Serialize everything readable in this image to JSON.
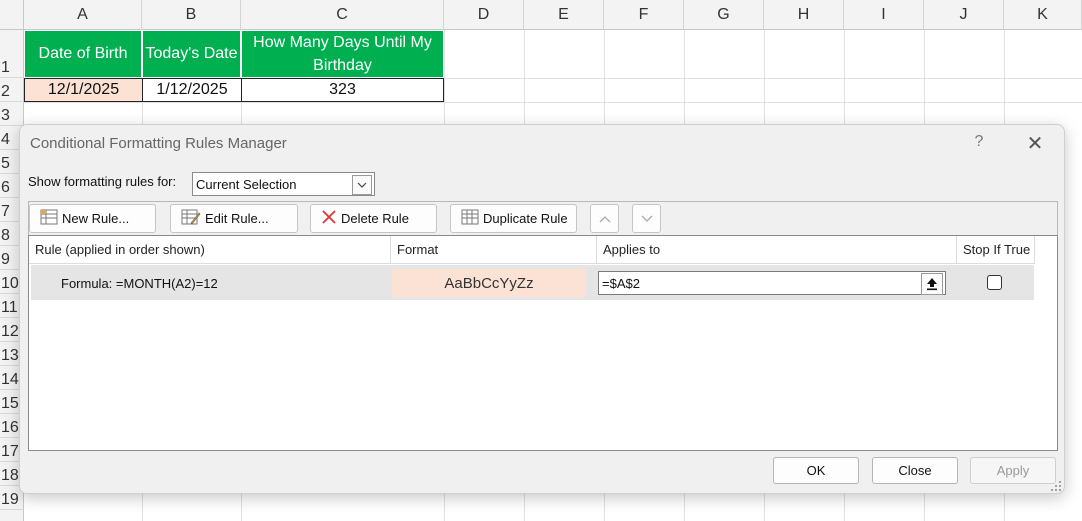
{
  "sheet": {
    "columns": [
      "A",
      "B",
      "C",
      "D",
      "E",
      "F",
      "G",
      "H",
      "I",
      "J",
      "K"
    ],
    "rows": [
      "1",
      "2",
      "3",
      "4",
      "5",
      "6",
      "7",
      "8",
      "9",
      "10",
      "11",
      "12",
      "13",
      "14",
      "15",
      "16",
      "17",
      "18",
      "19"
    ],
    "headers": {
      "a1": "Date of Birth",
      "b1": "Today's Date",
      "c1": "How Many Days Until My Birthday"
    },
    "values": {
      "a2": "12/1/2025",
      "b2": "1/12/2025",
      "c2": "323"
    },
    "header_fill": "#00b050",
    "highlight_fill": "#fbe2d5"
  },
  "dialog": {
    "title": "Conditional Formatting Rules Manager",
    "help": "?",
    "close": "✕",
    "show_rules_label": "Show formatting rules for:",
    "show_rules_value": "Current Selection",
    "buttons": {
      "new_rule": "New Rule...",
      "edit_rule": "Edit Rule...",
      "delete_rule": "Delete Rule",
      "duplicate_rule": "Duplicate Rule"
    },
    "columns": {
      "rule": "Rule (applied in order shown)",
      "format": "Format",
      "applies_to": "Applies to",
      "stop_if_true": "Stop If True"
    },
    "rule": {
      "condition": "Formula: =MONTH(A2)=12",
      "preview": "AaBbCcYyZz",
      "applies_to": "=$A$2",
      "stop_if_true": false
    },
    "footer": {
      "ok": "OK",
      "close": "Close",
      "apply": "Apply"
    }
  }
}
